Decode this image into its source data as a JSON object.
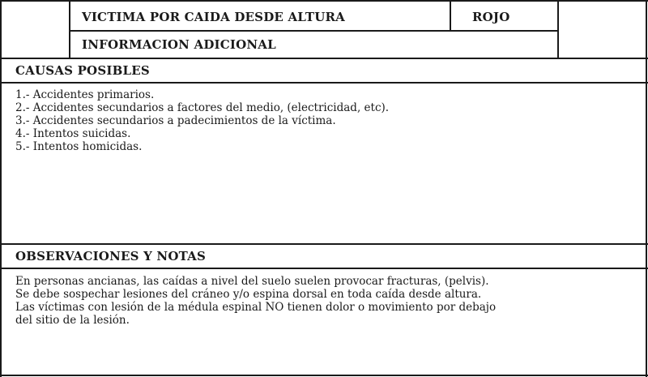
{
  "header": {
    "title": "VICTIMA POR CAIDA DESDE ALTURA",
    "color_code": "ROJO",
    "subtitle": "INFORMACION ADICIONAL"
  },
  "causes": {
    "heading": "CAUSAS POSIBLES",
    "items": [
      "1.- Accidentes primarios.",
      "2.- Accidentes secundarios a factores del medio, (electricidad, etc).",
      "3.- Accidentes secundarios a padecimientos de la víctima.",
      "4.- Intentos suicidas.",
      "5.- Intentos homicidas."
    ]
  },
  "notes": {
    "heading": "OBSERVACIONES Y NOTAS",
    "lines": [
      "En personas ancianas, las caídas a nivel del suelo suelen provocar fracturas, (pelvis).",
      "Se debe sospechar lesiones del cráneo y/o espina dorsal en toda caída desde altura.",
      "Las víctimas con lesión de la médula espinal NO tienen dolor o movimiento por debajo",
      "del sitio de la lesión."
    ]
  }
}
